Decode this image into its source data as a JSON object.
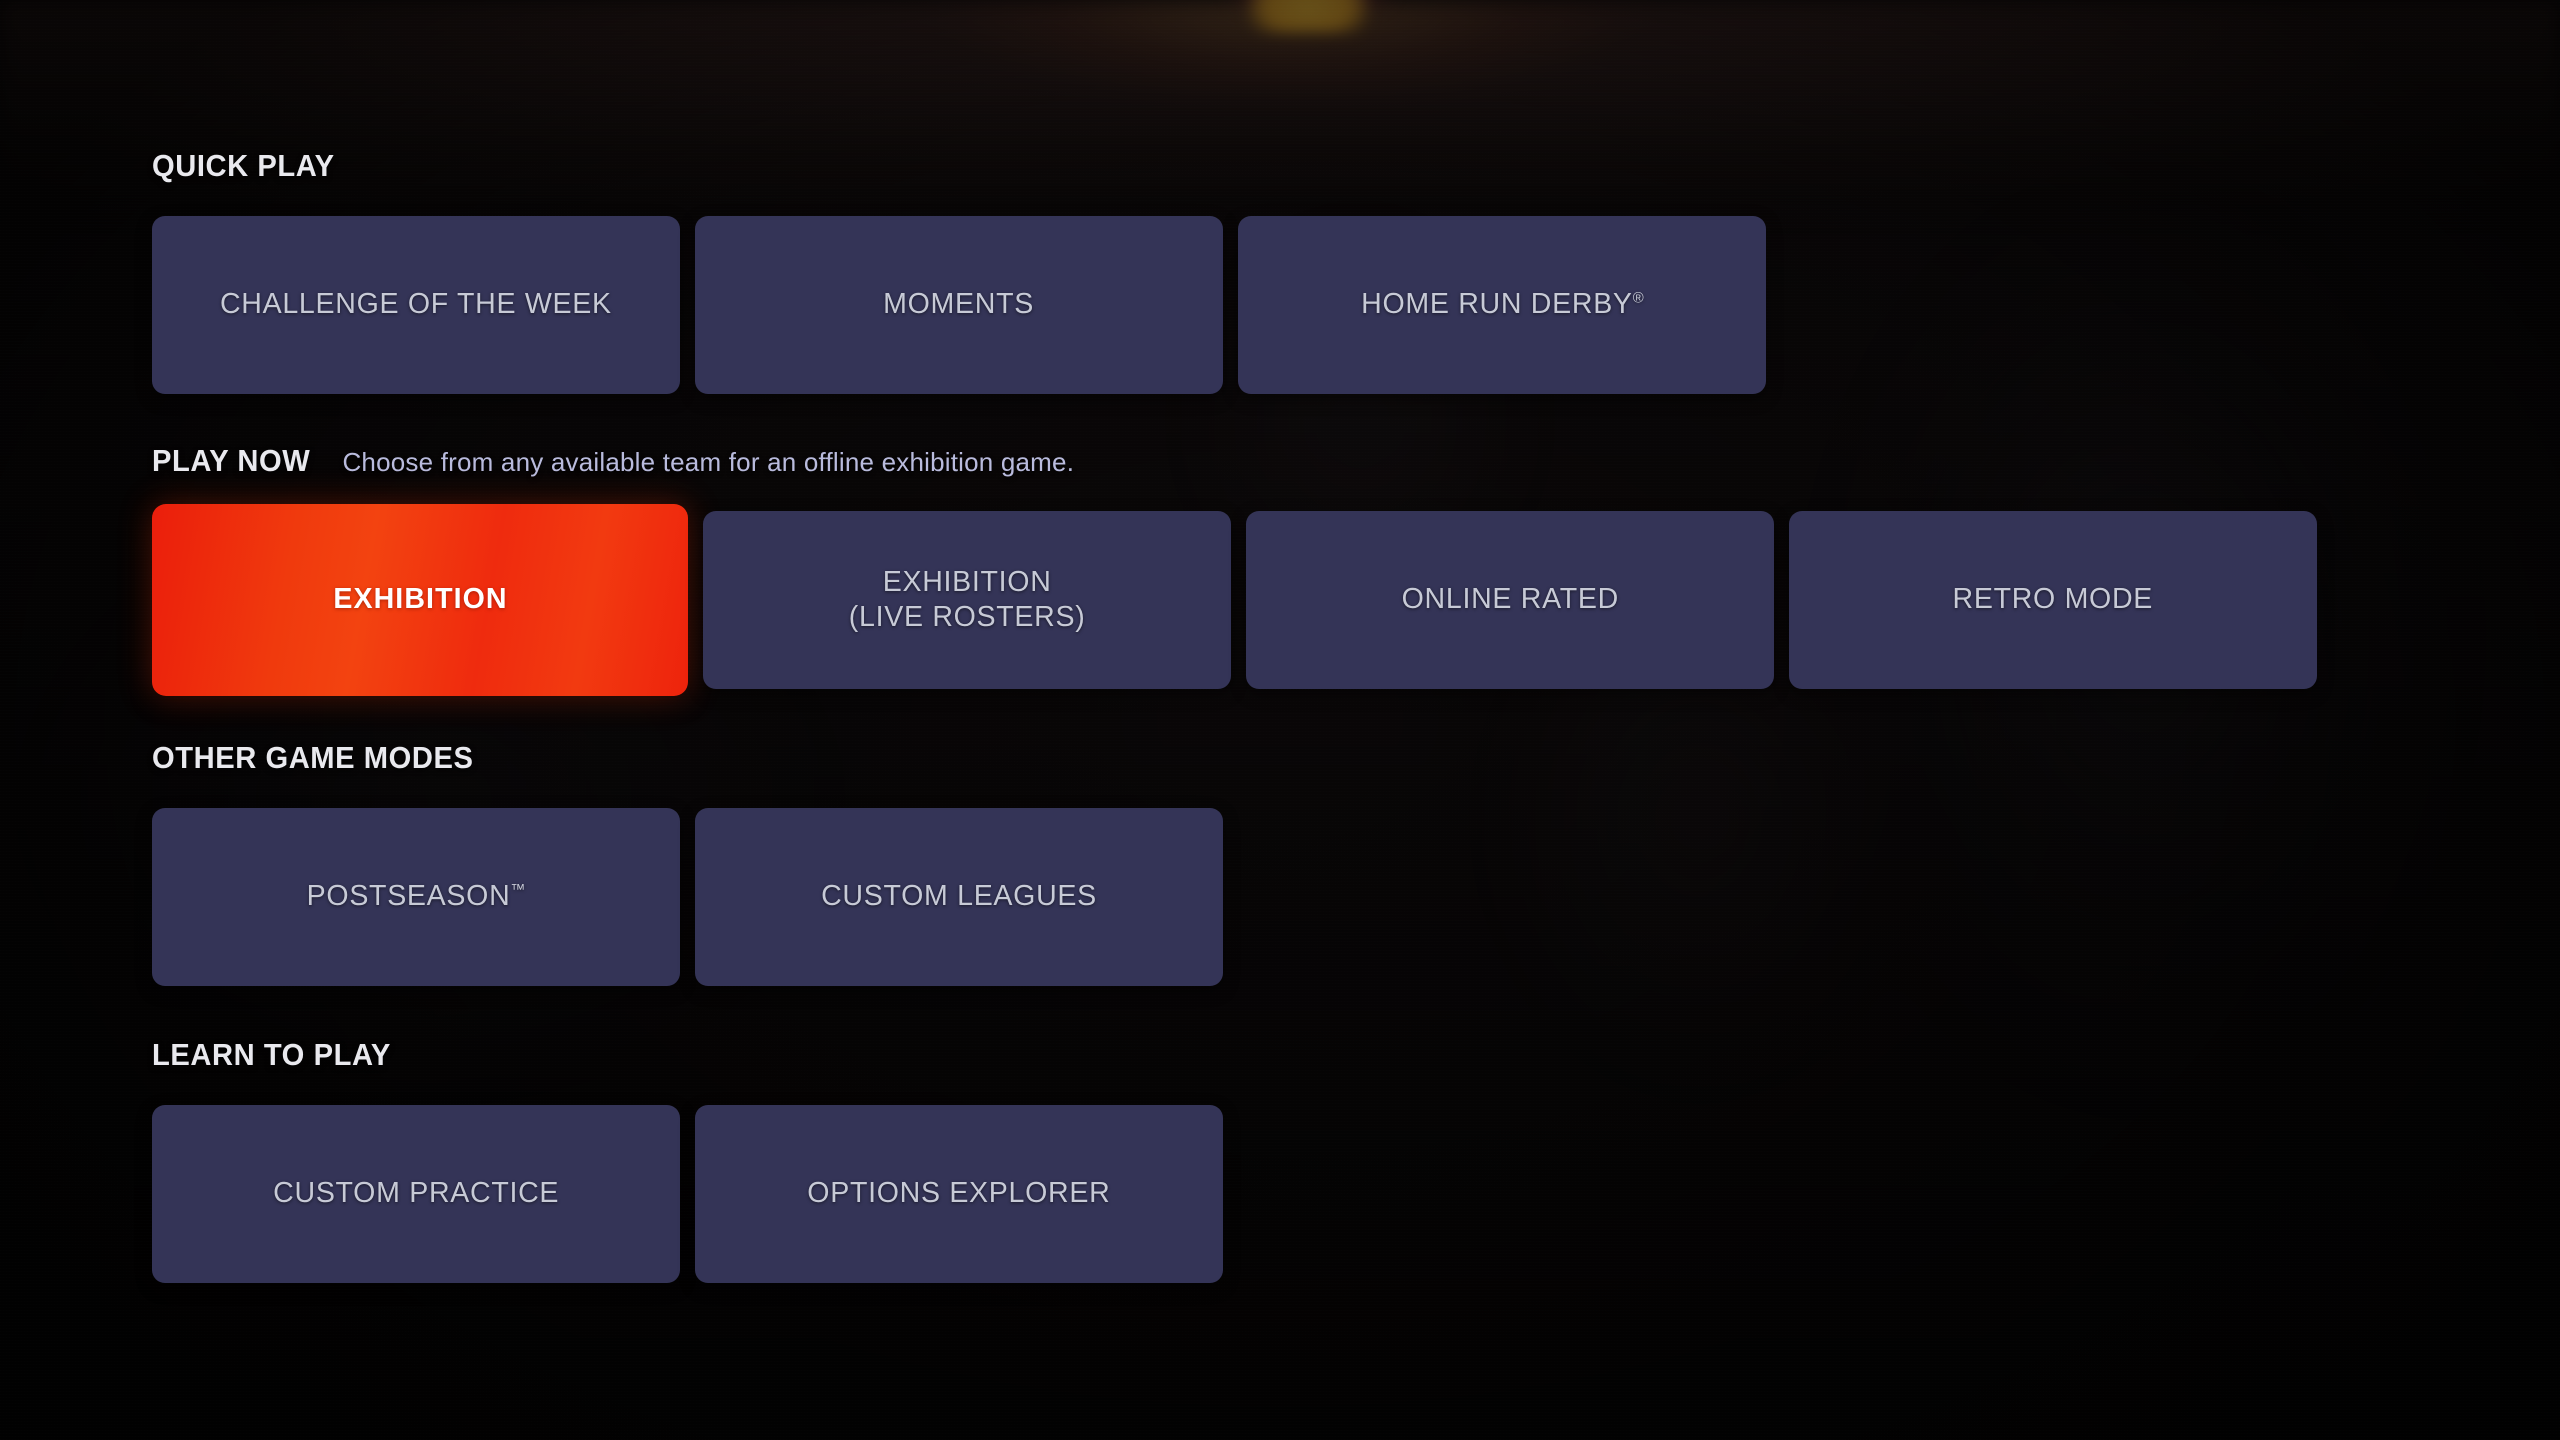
{
  "screen": {
    "name": "game-mode-select",
    "background_color": "#120d0e",
    "tile_color": "#343457",
    "tile_text_color": "#c7cad6",
    "selected_gradient_from": "#eb1e0c",
    "selected_gradient_to": "#f34310",
    "header_text_color": "#e9e9ee",
    "description_text_color": "#b9bbdd"
  },
  "sections": [
    {
      "id": "quick-play",
      "title": "QUICK PLAY",
      "description": "",
      "tiles": [
        {
          "label": "CHALLENGE OF THE WEEK",
          "selected": false
        },
        {
          "label": "MOMENTS",
          "selected": false
        },
        {
          "label": "HOME RUN DERBY",
          "trademark": "®",
          "selected": false
        }
      ]
    },
    {
      "id": "play-now",
      "title": "PLAY NOW",
      "description": "Choose from any available team for an offline exhibition game.",
      "tiles": [
        {
          "label": "EXHIBITION",
          "selected": true
        },
        {
          "label_line1": "EXHIBITION",
          "label_line2": "(LIVE ROSTERS)",
          "selected": false
        },
        {
          "label": "ONLINE RATED",
          "selected": false
        },
        {
          "label": "RETRO MODE",
          "selected": false
        }
      ]
    },
    {
      "id": "other-game-modes",
      "title": "OTHER GAME MODES",
      "description": "",
      "tiles": [
        {
          "label": "POSTSEASON",
          "trademark": "™",
          "selected": false
        },
        {
          "label": "CUSTOM LEAGUES",
          "selected": false
        }
      ]
    },
    {
      "id": "learn-to-play",
      "title": "LEARN TO PLAY",
      "description": "",
      "tiles": [
        {
          "label": "CUSTOM PRACTICE",
          "selected": false
        },
        {
          "label": "OPTIONS EXPLORER",
          "selected": false
        }
      ]
    }
  ]
}
